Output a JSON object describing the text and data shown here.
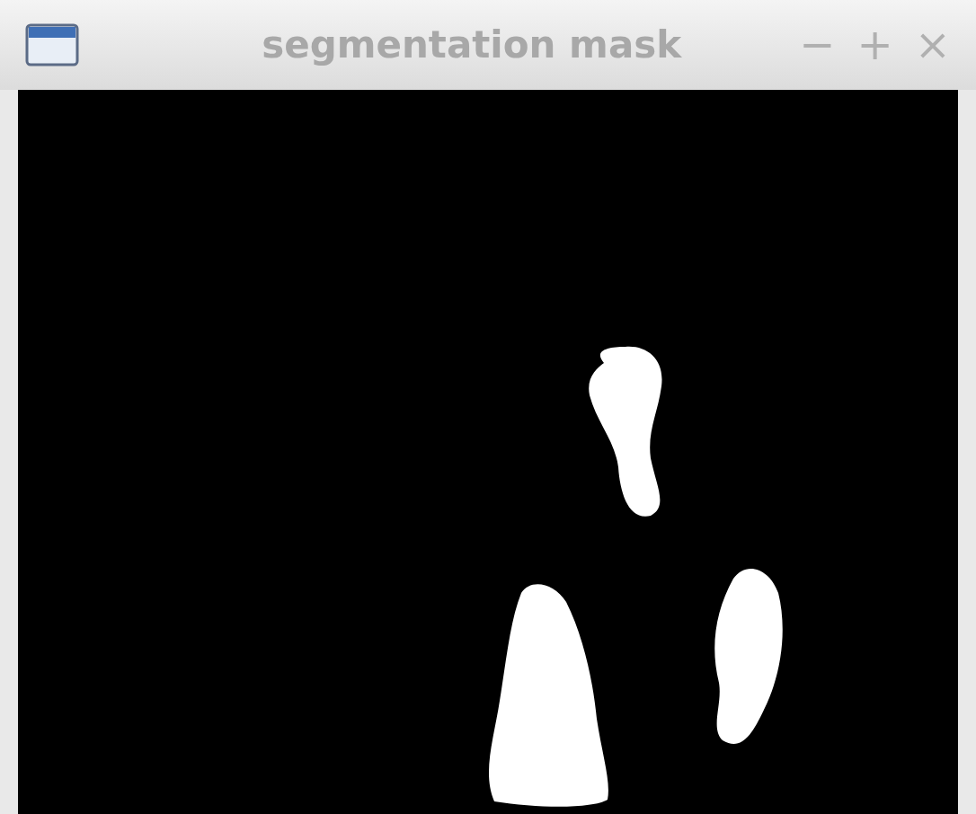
{
  "window": {
    "title": "segmentation mask",
    "controls": [
      "−",
      "+",
      "×"
    ]
  }
}
